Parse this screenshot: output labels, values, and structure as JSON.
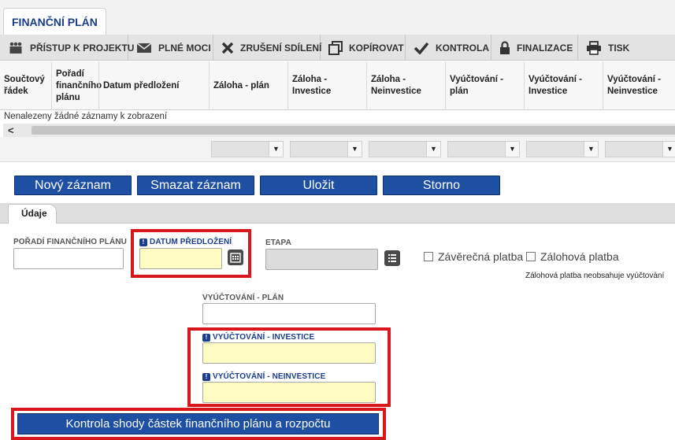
{
  "top_tab": {
    "label": "FINANČNÍ PLÁN"
  },
  "toolbar": {
    "items": [
      {
        "label": "PŘÍSTUP K PROJEKTU",
        "icon": "people-icon"
      },
      {
        "label": "PLNÉ MOCI",
        "icon": "envelope-icon"
      },
      {
        "label": "ZRUŠENÍ SDÍLENÍ",
        "icon": "x-icon"
      },
      {
        "label": "KOPÍROVAT",
        "icon": "copy-icon"
      },
      {
        "label": "KONTROLA",
        "icon": "check-icon"
      },
      {
        "label": "FINALIZACE",
        "icon": "lock-icon"
      },
      {
        "label": "TISK",
        "icon": "printer-icon"
      }
    ]
  },
  "grid": {
    "columns": [
      "Součtový řádek",
      "Pořadí finančního plánu",
      "Datum předložení",
      "Záloha - plán",
      "Záloha - Investice",
      "Záloha - Neinvestice",
      "Vyúčtování - plán",
      "Vyúčtování - Investice",
      "Vyúčtování - Neinvestice"
    ],
    "empty_message": "Nenalezeny žádné záznamy k zobrazení",
    "scroll_left_glyph": "<",
    "filter_caret": "▼"
  },
  "actions": {
    "new": "Nový záznam",
    "delete": "Smazat záznam",
    "save": "Uložit",
    "cancel": "Storno"
  },
  "detail_tab": {
    "label": "Údaje"
  },
  "form": {
    "poradi_label": "POŘADÍ FINANČNÍHO PLÁNU",
    "datum_label": "DATUM PŘEDLOŽENÍ",
    "etapa_label": "ETAPA",
    "zaverecna_label": "Závěrečná platba",
    "zalohova_label": "Zálohová platba",
    "zalohova_note": "Zálohová platba neobsahuje vyúčtování",
    "vyuct_plan_label": "VYÚČTOVÁNÍ - PLÁN",
    "vyuct_inv_label": "VYÚČTOVÁNÍ - INVESTICE",
    "vyuct_neinv_label": "VYÚČTOVÁNÍ - NEINVESTICE",
    "required_mark": "!"
  },
  "check_button": {
    "label": "Kontrola shody částek finančního plánu a rozpočtu"
  },
  "colors": {
    "primary_blue": "#1d4fa3",
    "required_yellow": "#fefcc0",
    "highlight_red": "#d9161c"
  }
}
